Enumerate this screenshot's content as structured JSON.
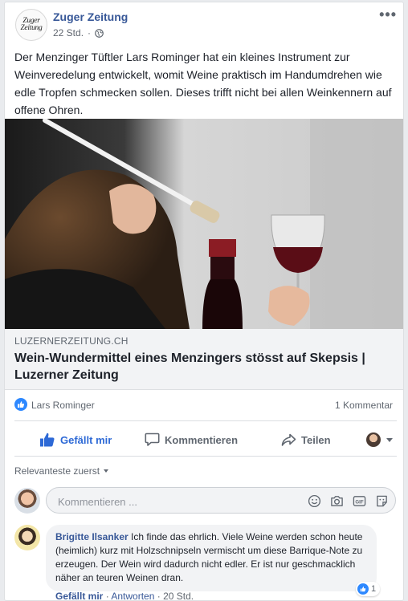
{
  "post": {
    "page_logo_text": "Zuger\nZeitung",
    "page_name": "Zuger Zeitung",
    "time": "22 Std.",
    "text": "Der Menzinger Tüftler Lars Rominger hat ein kleines Instrument zur Weinveredelung entwickelt, womit Weine praktisch im Handumdrehen wie edle Tropfen schmecken sollen. Dieses trifft nicht bei allen Weinkennern auf offene Ohren.",
    "more_label": "•••"
  },
  "link": {
    "domain": "LUZERNERZEITUNG.CH",
    "title": "Wein-Wundermittel eines Menzingers stösst auf Skepsis | Luzerner Zeitung"
  },
  "reactions": {
    "reactor": "Lars Rominger",
    "comment_count": "1 Kommentar"
  },
  "actions": {
    "like": "Gefällt mir",
    "comment": "Kommentieren",
    "share": "Teilen"
  },
  "comments": {
    "sort_label": "Relevanteste zuerst",
    "input_placeholder": "Kommentieren ...",
    "items": [
      {
        "author": "Brigitte Ilsanker",
        "text": "Ich finde das ehrlich. Viele Weine werden schon heute (heimlich) kurz mit Holzschnipseln vermischt um diese Barrique-Note zu erzeugen. Der Wein wird dadurch nicht edler. Er ist nur geschmacklich näher an teuren Weinen dran.",
        "likes": "1",
        "like_label": "Gefällt mir",
        "reply_label": "Antworten",
        "time": "20 Std."
      }
    ]
  },
  "colors": {
    "brand_link": "#385898",
    "like_blue": "#2d88ff",
    "muted": "#606770",
    "background": "#e9ebee"
  }
}
